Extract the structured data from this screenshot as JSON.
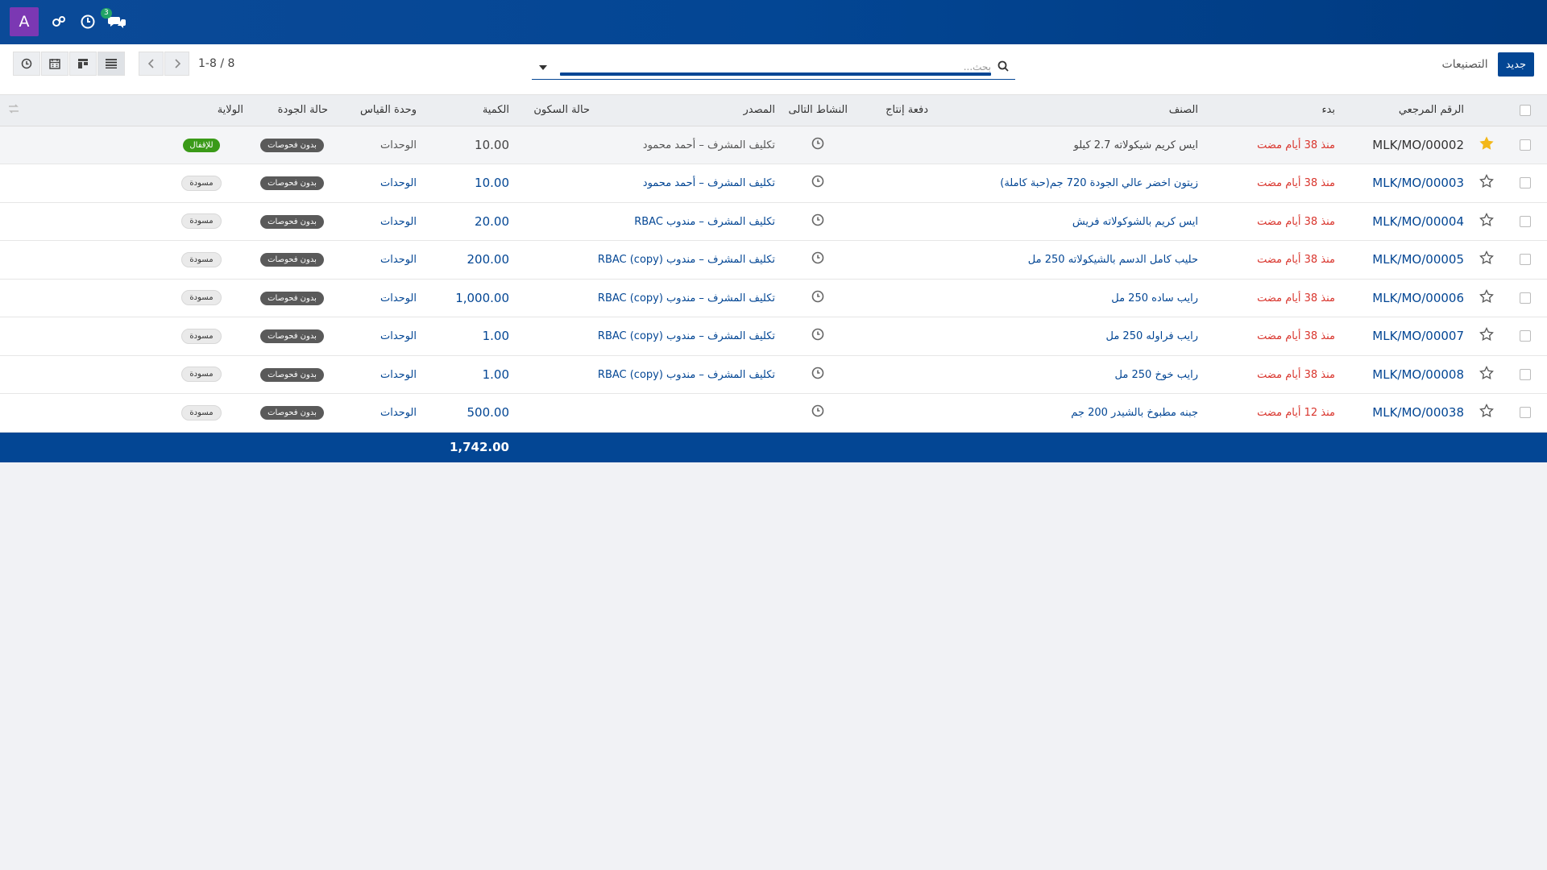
{
  "navbar": {
    "avatar_letter": "A",
    "chat_badge": "3",
    "icons": [
      "avatar",
      "cogs-icon",
      "clock-icon",
      "chat-icon"
    ]
  },
  "control": {
    "new_label": "جديد",
    "breadcrumb": "التصنيعات",
    "search_placeholder": "بحث...",
    "pager": "1-8 / 8"
  },
  "table": {
    "headers": {
      "reference": "الرقم المرجعي",
      "start": "بدء",
      "product": "الصنف",
      "lot": "دفعة إنتاج",
      "next_activity": "النشاط التالى",
      "source": "المصدر",
      "idle_state": "حالة السكون",
      "quantity": "الكمية",
      "uom": "وحدة القياس",
      "quality": "حالة الجودة",
      "state": "الولاية"
    },
    "rows": [
      {
        "ref": "MLK/MO/00002",
        "start": "منذ 38 أيام مضت",
        "product": "ايس كريم شيكولاته 2.7 كيلو",
        "source": "تكليف المشرف – أحمد محمود",
        "qty": "10.00",
        "uom": "الوحدات",
        "quality": "بدون فحوصات",
        "state": "للإقفال",
        "starred": true,
        "linked": false
      },
      {
        "ref": "MLK/MO/00003",
        "start": "منذ 38 أيام مضت",
        "product": "زيتون اخضر عالي الجودة 720 جم(حبة كاملة)",
        "source": "تكليف المشرف – أحمد محمود",
        "qty": "10.00",
        "uom": "الوحدات",
        "quality": "بدون فحوصات",
        "state": "مسودة",
        "starred": false,
        "linked": true
      },
      {
        "ref": "MLK/MO/00004",
        "start": "منذ 38 أيام مضت",
        "product": "ايس كريم بالشوكولاته فريش",
        "source": "تكليف المشرف – مندوب RBAC",
        "qty": "20.00",
        "uom": "الوحدات",
        "quality": "بدون فحوصات",
        "state": "مسودة",
        "starred": false,
        "linked": true
      },
      {
        "ref": "MLK/MO/00005",
        "start": "منذ 38 أيام مضت",
        "product": "حليب كامل الدسم بالشيكولاته 250 مل",
        "source": "تكليف المشرف – مندوب RBAC (copy)",
        "qty": "200.00",
        "uom": "الوحدات",
        "quality": "بدون فحوصات",
        "state": "مسودة",
        "starred": false,
        "linked": true
      },
      {
        "ref": "MLK/MO/00006",
        "start": "منذ 38 أيام مضت",
        "product": "رايب ساده 250 مل",
        "source": "تكليف المشرف – مندوب RBAC (copy)",
        "qty": "1,000.00",
        "uom": "الوحدات",
        "quality": "بدون فحوصات",
        "state": "مسودة",
        "starred": false,
        "linked": true
      },
      {
        "ref": "MLK/MO/00007",
        "start": "منذ 38 أيام مضت",
        "product": "رايب فراوله 250 مل",
        "source": "تكليف المشرف – مندوب RBAC (copy)",
        "qty": "1.00",
        "uom": "الوحدات",
        "quality": "بدون فحوصات",
        "state": "مسودة",
        "starred": false,
        "linked": true
      },
      {
        "ref": "MLK/MO/00008",
        "start": "منذ 38 أيام مضت",
        "product": "رايب خوخ 250 مل",
        "source": "تكليف المشرف – مندوب RBAC (copy)",
        "qty": "1.00",
        "uom": "الوحدات",
        "quality": "بدون فحوصات",
        "state": "مسودة",
        "starred": false,
        "linked": true
      },
      {
        "ref": "MLK/MO/00038",
        "start": "منذ 12 أيام مضت",
        "product": "جبنه مطبوخ بالشيدر 200 جم",
        "source": "",
        "qty": "500.00",
        "uom": "الوحدات",
        "quality": "بدون فحوصات",
        "state": "مسودة",
        "starred": false,
        "linked": true
      }
    ],
    "total_qty": "1,742.00"
  },
  "colors": {
    "brand": "#034694",
    "avatar": "#7b38b3",
    "date_red": "#d9352d",
    "state_green": "#3a9a18",
    "star_gold": "#f3b718"
  }
}
